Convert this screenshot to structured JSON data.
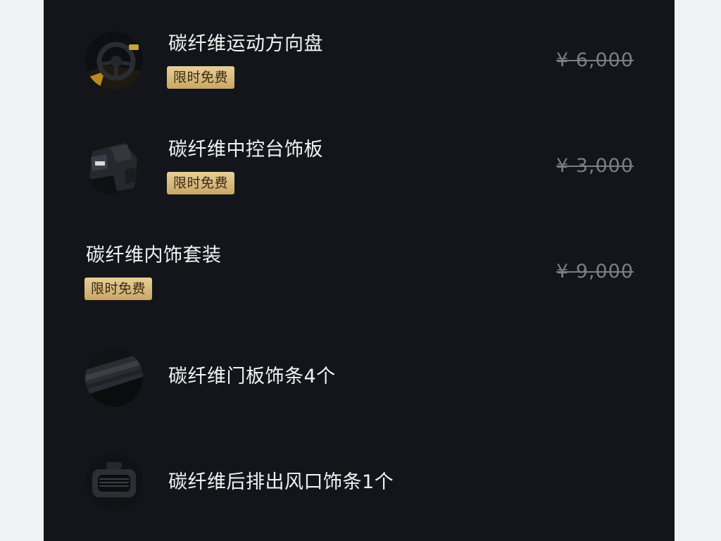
{
  "items": [
    {
      "name": "碳纤维运动方向盘",
      "badge": "限时免费",
      "price": "¥ 6,000",
      "image": "steering-wheel"
    },
    {
      "name": "碳纤维中控台饰板",
      "badge": "限时免费",
      "price": "¥ 3,000",
      "image": "center-console"
    },
    {
      "name": "碳纤维内饰套装",
      "badge": "限时免费",
      "price": "¥ 9,000"
    },
    {
      "name": "碳纤维门板饰条4个",
      "image": "door-trim"
    },
    {
      "name": "碳纤维后排出风口饰条1个",
      "image": "rear-vent"
    }
  ],
  "colors": {
    "panel_background": "#13151b",
    "badge_gold": "#d6b878",
    "strike_price": "#7b7d82"
  }
}
